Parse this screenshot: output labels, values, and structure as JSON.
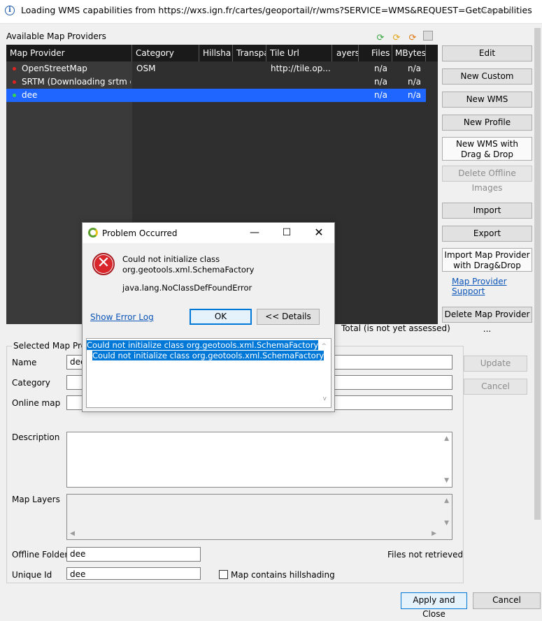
{
  "window": {
    "title": "Loading WMS capabilities from https://wxs.ign.fr/cartes/geoportail/r/wms?SERVICE=WMS&REQUEST=GetCapabilities"
  },
  "providers": {
    "section_label": "Available Map Providers",
    "columns": [
      "Map Provider",
      "Category",
      "Hillsha",
      "Transpa",
      "Tile Url",
      "ayers",
      "Files",
      "MBytes"
    ],
    "rows": [
      {
        "name": "OpenStreetMap",
        "category": "OSM",
        "tile_url": "http://tile.op...",
        "files": "n/a",
        "mbytes": "n/a",
        "status_color": "#e02424",
        "selected": false
      },
      {
        "name": "SRTM (Downloading srtm d...",
        "category": "",
        "tile_url": "",
        "files": "n/a",
        "mbytes": "n/a",
        "status_color": "#e02424",
        "selected": false
      },
      {
        "name": "dee",
        "category": "",
        "tile_url": "",
        "files": "n/a",
        "mbytes": "n/a",
        "status_color": "#39d353",
        "selected": true
      }
    ],
    "total_text": "Total (is not yet assessed)"
  },
  "side_buttons": {
    "edit": "Edit",
    "new_custom": "New Custom",
    "new_wms": "New WMS",
    "new_profile": "New Profile",
    "new_wms_drag_1": "New WMS with",
    "new_wms_drag_2": "Drag & Drop",
    "delete_offline": "Delete Offline Images",
    "import": "Import",
    "export": "Export",
    "import_drag_1": "Import Map Provider",
    "import_drag_2": "with Drag&Drop",
    "support_link": "Map Provider Support",
    "delete_provider": "Delete Map Provider ..."
  },
  "selected": {
    "group_label": "Selected Map Provi",
    "name_label": "Name",
    "name_value": "dee",
    "category_label": "Category",
    "online_label": "Online map",
    "description_label": "Description",
    "layers_label": "Map Layers",
    "offline_label": "Offline Folder",
    "offline_value": "dee",
    "unique_label": "Unique Id",
    "unique_value": "dee",
    "files_status": "Files not retrieved",
    "hillshading_label": "Map contains hillshading",
    "update": "Update",
    "cancel": "Cancel"
  },
  "bottom": {
    "apply_close": "Apply and Close",
    "cancel": "Cancel"
  },
  "dialog": {
    "title": "Problem Occurred",
    "message_1": "Could not initialize class",
    "message_2": "org.geotools.xml.SchemaFactory",
    "exception": "java.lang.NoClassDefFoundError",
    "show_log": "Show Error Log",
    "ok": "OK",
    "details": "<< Details",
    "detail_line_1": "Could not initialize class org.geotools.xml.SchemaFactory",
    "detail_line_2": "Could not initialize class org.geotools.xml.SchemaFactory"
  }
}
